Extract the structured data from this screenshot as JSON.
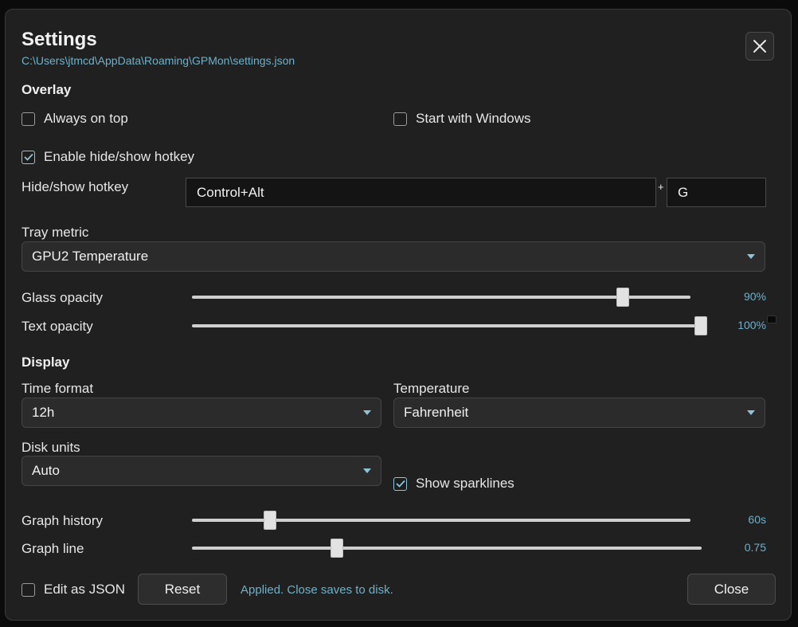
{
  "header": {
    "title": "Settings",
    "path": "C:\\Users\\jtmcd\\AppData\\Roaming\\GPMon\\settings.json"
  },
  "overlay": {
    "section_label": "Overlay",
    "always_on_top": {
      "label": "Always on top",
      "checked": false
    },
    "start_with_windows": {
      "label": "Start with Windows",
      "checked": false
    },
    "enable_hotkey": {
      "label": "Enable hide/show hotkey",
      "checked": true
    },
    "hotkey": {
      "label": "Hide/show hotkey",
      "modifiers": "Control+Alt",
      "plus": "+",
      "key": "G"
    },
    "tray_metric": {
      "label": "Tray metric",
      "value": "GPU2 Temperature"
    },
    "glass_opacity": {
      "label": "Glass opacity",
      "value_text": "90%",
      "value": 0.9
    },
    "text_opacity": {
      "label": "Text opacity",
      "value_text": "100%",
      "value": 1.0
    }
  },
  "display": {
    "section_label": "Display",
    "time_format": {
      "label": "Time format",
      "value": "12h"
    },
    "temperature": {
      "label": "Temperature",
      "value": "Fahrenheit"
    },
    "disk_units": {
      "label": "Disk units",
      "value": "Auto"
    },
    "show_sparklines": {
      "label": "Show sparklines",
      "checked": true
    },
    "graph_history": {
      "label": "Graph history",
      "value_text": "60s",
      "value": 0.155
    },
    "graph_line": {
      "label": "Graph line",
      "value_text": "0.75",
      "value": 0.28
    }
  },
  "footer": {
    "edit_json": {
      "label": "Edit as JSON",
      "checked": false
    },
    "reset_label": "Reset",
    "status": "Applied. Close saves to disk.",
    "close_label": "Close"
  },
  "colors": {
    "accent": "#6fb0c8",
    "background": "#202020"
  }
}
